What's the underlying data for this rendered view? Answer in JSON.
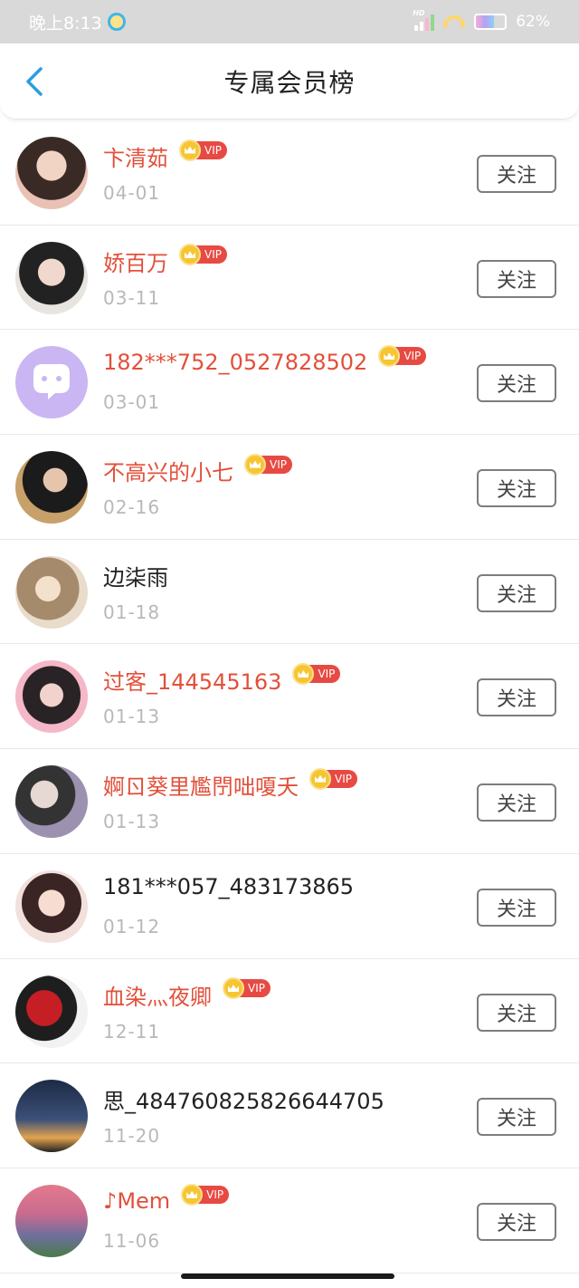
{
  "status_bar": {
    "time": "晚上8:13",
    "network_label": "HD",
    "battery": "62%",
    "battery_level": 0.62
  },
  "nav": {
    "title": "专属会员榜",
    "back_icon": "chevron-left-icon"
  },
  "vip_label": "VIP",
  "follow_label": "关注",
  "members": [
    {
      "name": "卞清茹",
      "date": "04-01",
      "vip": true
    },
    {
      "name": "娇百万",
      "date": "03-11",
      "vip": true
    },
    {
      "name": "182***752_0527828502",
      "date": "03-01",
      "vip": true
    },
    {
      "name": "不高兴的小七",
      "date": "02-16",
      "vip": true
    },
    {
      "name": "边柒雨",
      "date": "01-18",
      "vip": false
    },
    {
      "name": "过客_144545163",
      "date": "01-13",
      "vip": true
    },
    {
      "name": "婀ㄖ葵里尷閅咄嗄夭",
      "date": "01-13",
      "vip": true
    },
    {
      "name": "181***057_483173865",
      "date": "01-12",
      "vip": false
    },
    {
      "name": "血染灬夜卿",
      "date": "12-11",
      "vip": true
    },
    {
      "name": "思_484760825826644705",
      "date": "11-20",
      "vip": false
    },
    {
      "name": "♪Mem",
      "date": "11-06",
      "vip": true
    }
  ],
  "colors": {
    "vip_name": "#e2503b",
    "normal_name": "#222222",
    "date": "#b8b8b8",
    "back_arrow": "#2b9de0",
    "vip_badge": "#e74a43",
    "vip_crown": "#f6c531"
  }
}
